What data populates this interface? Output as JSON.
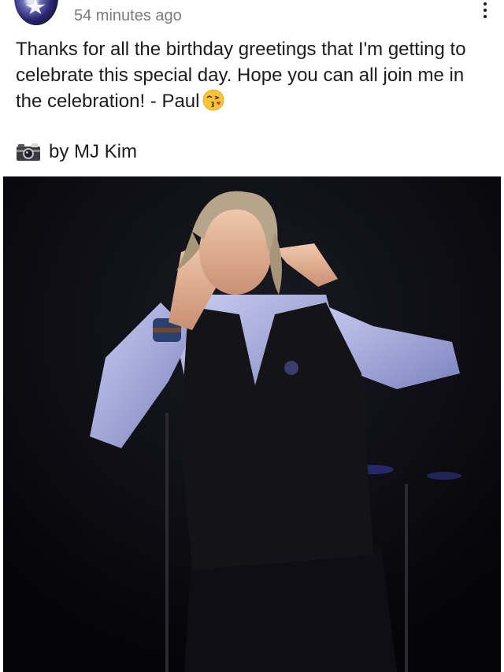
{
  "post": {
    "timestamp": "54 minutes ago",
    "caption": "Thanks for all the birthday greetings that I'm getting to celebrate this special day. Hope you can all join me in the celebration! - Paul",
    "caption_emoji": "face-blowing-a-kiss",
    "credit_icon": "camera-with-flash-icon",
    "credit_text": "by MJ Kim",
    "menu_icon": "vertical-ellipsis-icon",
    "photo_description_icon": "photo"
  },
  "colors": {
    "text": "#1c1c1e",
    "secondary_text": "#7a7a7f",
    "background": "#ffffff",
    "photo_background": "#06060a"
  }
}
